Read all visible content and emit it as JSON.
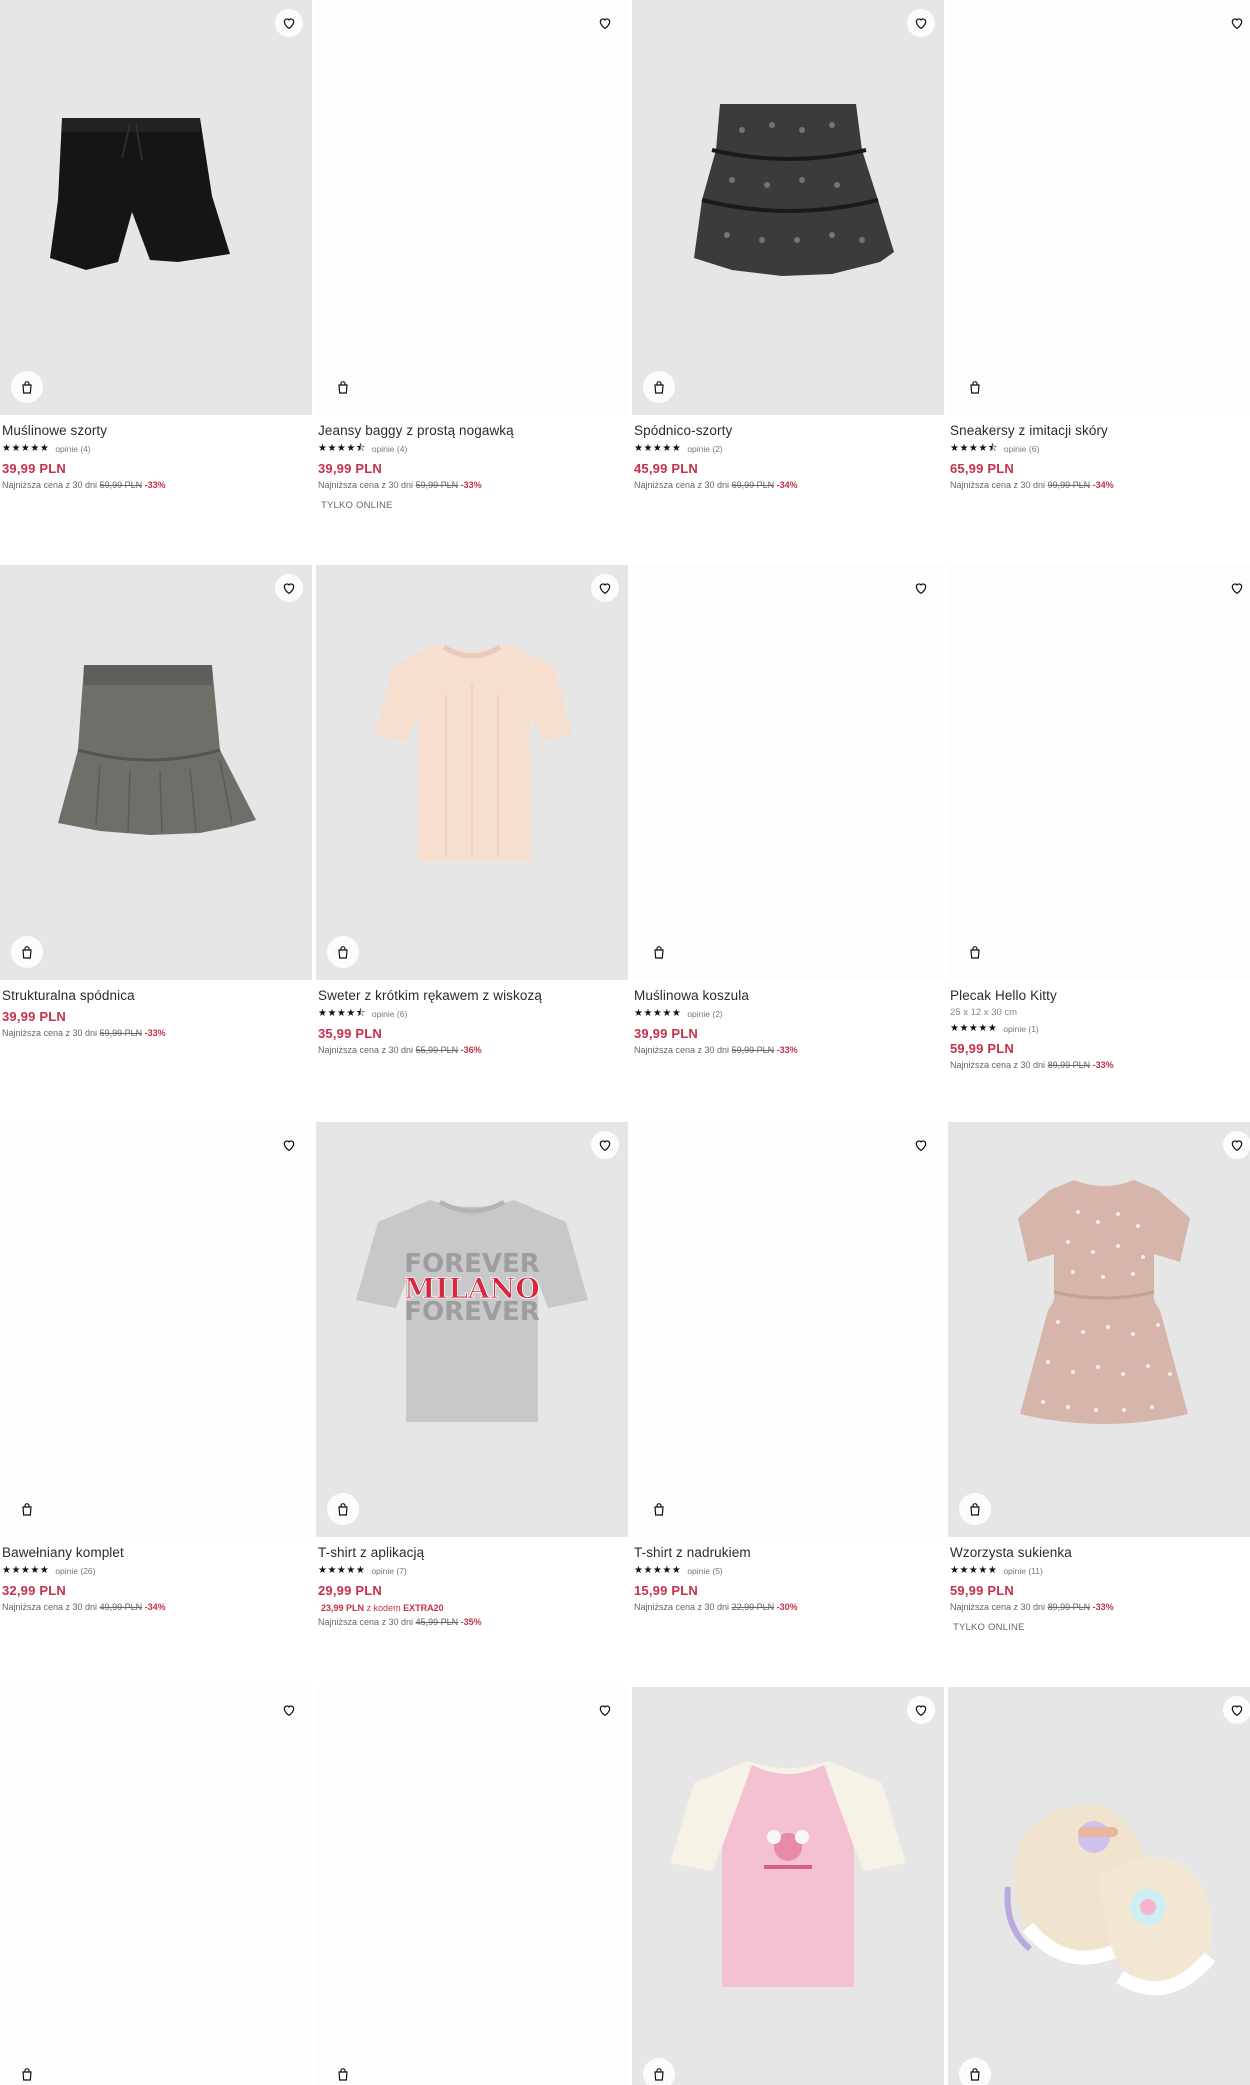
{
  "colors": {
    "accent": "#c7304a",
    "text": "#2b2b2b",
    "muted": "#666666"
  },
  "icons": {
    "wishlist": "heart-icon",
    "cart": "shopping-bag-icon",
    "star": "star-icon"
  },
  "products": [
    {
      "name": "Muślinowe szorty",
      "rating": 5,
      "reviews": "opinie (4)",
      "price": "39,99 PLN",
      "lowest_label": "Najniższa cena z 30 dni",
      "old_price": "59,99 PLN",
      "discount": "-33%"
    },
    {
      "name": "Jeansy baggy z prostą nogawką",
      "rating": 4.5,
      "reviews": "opinie (4)",
      "price": "39,99 PLN",
      "lowest_label": "Najniższa cena z 30 dni",
      "old_price": "59,99 PLN",
      "discount": "-33%",
      "badge": "TYLKO ONLINE"
    },
    {
      "name": "Spódnico-szorty",
      "rating": 5,
      "reviews": "opinie (2)",
      "price": "45,99 PLN",
      "lowest_label": "Najniższa cena z 30 dni",
      "old_price": "69,99 PLN",
      "discount": "-34%"
    },
    {
      "name": "Sneakersy z imitacji skóry",
      "rating": 4.5,
      "reviews": "opinie (6)",
      "price": "65,99 PLN",
      "lowest_label": "Najniższa cena z 30 dni",
      "old_price": "99,99 PLN",
      "discount": "-34%"
    },
    {
      "name": "Strukturalna spódnica",
      "price": "39,99 PLN",
      "lowest_label": "Najniższa cena z 30 dni",
      "old_price": "59,99 PLN",
      "discount": "-33%"
    },
    {
      "name": "Sweter z krótkim rękawem z wiskozą",
      "rating": 4.5,
      "reviews": "opinie (6)",
      "price": "35,99 PLN",
      "lowest_label": "Najniższa cena z 30 dni",
      "old_price": "55,99 PLN",
      "discount": "-36%"
    },
    {
      "name": "Muślinowa koszula",
      "rating": 5,
      "reviews": "opinie (2)",
      "price": "39,99 PLN",
      "lowest_label": "Najniższa cena z 30 dni",
      "old_price": "59,99 PLN",
      "discount": "-33%"
    },
    {
      "name": "Plecak Hello Kitty",
      "dimensions": "25 x 12 x 30 cm",
      "rating": 5,
      "reviews": "opinie (1)",
      "price": "59,99 PLN",
      "lowest_label": "Najniższa cena z 30 dni",
      "old_price": "89,99 PLN",
      "discount": "-33%"
    },
    {
      "name": "Bawełniany komplet",
      "rating": 5,
      "reviews": "opinie (26)",
      "price": "32,99 PLN",
      "lowest_label": "Najniższa cena z 30 dni",
      "old_price": "49,99 PLN",
      "discount": "-34%"
    },
    {
      "name": "T-shirt z aplikacją",
      "rating": 5,
      "reviews": "opinie (7)",
      "price": "29,99 PLN",
      "code_price": "23,99 PLN",
      "code_label": "z kodem",
      "code": "EXTRA20",
      "lowest_label": "Najniższa cena z 30 dni",
      "old_price": "45,99 PLN",
      "discount": "-35%"
    },
    {
      "name": "T-shirt z nadrukiem",
      "rating": 5,
      "reviews": "opinie (5)",
      "price": "15,99 PLN",
      "lowest_label": "Najniższa cena z 30 dni",
      "old_price": "22,99 PLN",
      "discount": "-30%"
    },
    {
      "name": "Wzorzysta sukienka",
      "rating": 5,
      "reviews": "opinie (11)",
      "price": "59,99 PLN",
      "lowest_label": "Najniższa cena z 30 dni",
      "old_price": "89,99 PLN",
      "discount": "-33%",
      "badge": "TYLKO ONLINE"
    },
    {
      "name": ""
    },
    {
      "name": ""
    },
    {
      "name": ""
    },
    {
      "name": ""
    }
  ],
  "print_texts": {
    "tshirt_forever_top": "FOREVER",
    "tshirt_milano": "MILANO",
    "tshirt_forever_bottom": "FOREVER"
  }
}
